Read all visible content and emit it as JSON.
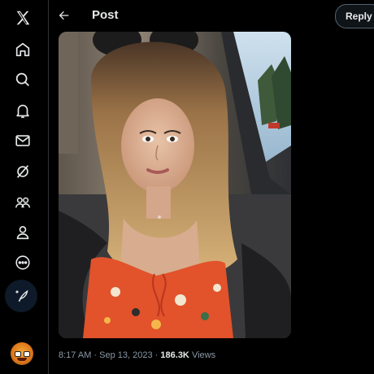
{
  "nav": {
    "items": [
      {
        "icon": "x-logo-icon"
      },
      {
        "icon": "home-icon"
      },
      {
        "icon": "search-icon"
      },
      {
        "icon": "bell-icon"
      },
      {
        "icon": "mail-icon"
      },
      {
        "icon": "grok-icon"
      },
      {
        "icon": "communities-icon"
      },
      {
        "icon": "profile-icon"
      },
      {
        "icon": "more-icon"
      },
      {
        "icon": "compose-icon"
      }
    ],
    "avatar_icon": "account-avatar"
  },
  "header": {
    "title": "Post",
    "reply_label": "Reply"
  },
  "post": {
    "image_icon": "selfie-photo",
    "time": "8:17 AM",
    "separator": "·",
    "date": "Sep 13, 2023",
    "views_count": "186.3K",
    "views_label": "Views"
  },
  "colors": {
    "background": "#000000",
    "text": "#e7e9ea",
    "muted": "#8b98a5",
    "border": "#2f3336"
  }
}
